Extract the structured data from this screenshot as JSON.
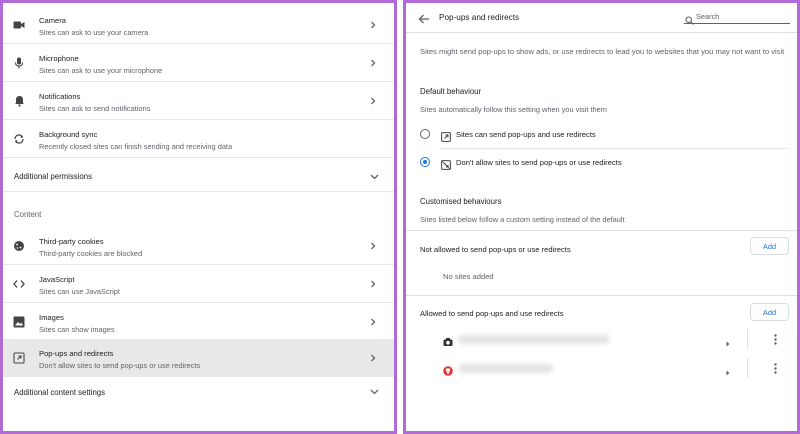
{
  "left_panel": {
    "permissions": [
      {
        "title": "Camera",
        "subtitle": "Sites can ask to use your camera",
        "icon": "camera-icon"
      },
      {
        "title": "Microphone",
        "subtitle": "Sites can ask to use your microphone",
        "icon": "microphone-icon"
      },
      {
        "title": "Notifications",
        "subtitle": "Sites can ask to send notifications",
        "icon": "bell-icon"
      },
      {
        "title": "Background sync",
        "subtitle": "Recently closed sites can finish sending and receiving data",
        "icon": "sync-icon"
      }
    ],
    "additional_permissions": "Additional permissions",
    "content_heading": "Content",
    "content_items": [
      {
        "title": "Third-party cookies",
        "subtitle": "Third-party cookies are blocked",
        "icon": "cookie-icon"
      },
      {
        "title": "JavaScript",
        "subtitle": "Sites can use JavaScript",
        "icon": "code-icon"
      },
      {
        "title": "Images",
        "subtitle": "Sites can show images",
        "icon": "image-icon"
      },
      {
        "title": "Pop-ups and redirects",
        "subtitle": "Don't allow sites to send pop-ups or use redirects",
        "icon": "open-external-icon",
        "selected": true
      }
    ],
    "additional_content_settings": "Additional content settings"
  },
  "right_panel": {
    "title": "Pop-ups and redirects",
    "search_placeholder": "Search",
    "description": "Sites might send pop-ups to show ads, or use redirects to lead you to websites that you may not want to visit",
    "default_behaviour": {
      "heading": "Default behaviour",
      "subheading": "Sites automatically follow this setting when you visit them",
      "options": [
        {
          "label": "Sites can send pop-ups and use redirects",
          "checked": false,
          "icon": "open-external-icon"
        },
        {
          "label": "Don't allow sites to send pop-ups or use redirects",
          "checked": true,
          "icon": "popup-blocked-icon"
        }
      ]
    },
    "customised_behaviours": {
      "heading": "Customised behaviours",
      "subheading": "Sites listed below follow a custom setting instead of the default",
      "not_allowed": {
        "label": "Not allowed to send pop-ups or use redirects",
        "add_label": "Add",
        "empty_text": "No sites added"
      },
      "allowed": {
        "label": "Allowed to send pop-ups and use redirects",
        "add_label": "Add",
        "sites": [
          {
            "icon": "camera-favicon-icon"
          },
          {
            "icon": "red-favicon-icon"
          }
        ]
      }
    }
  },
  "colors": {
    "frame_border": "#b06cd6",
    "accent": "#1a73e8",
    "selected_row": "#e8e8e8"
  }
}
